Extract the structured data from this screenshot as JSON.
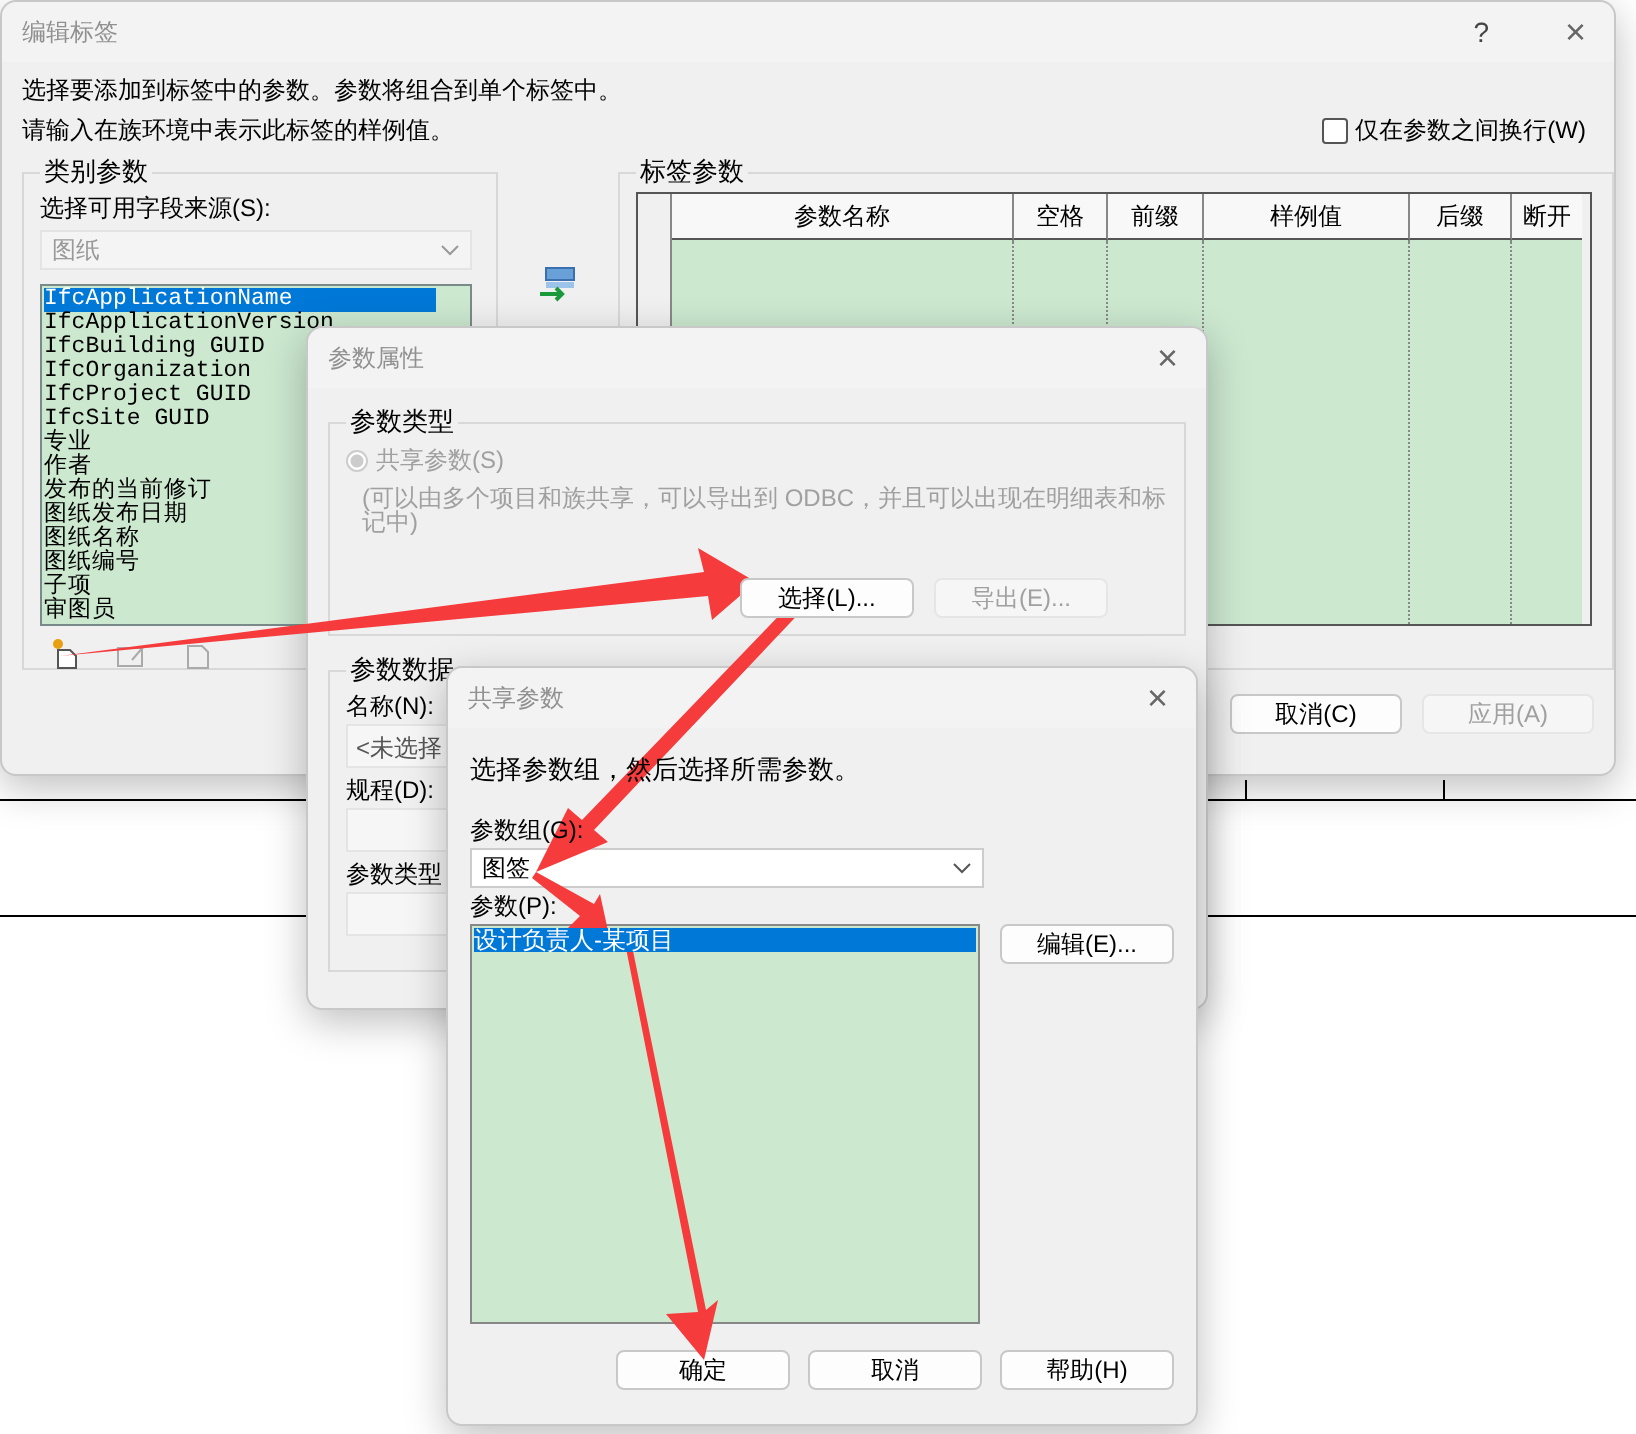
{
  "main_dialog": {
    "title": "编辑标签",
    "help": "?",
    "close": "×",
    "instructions": [
      "选择要添加到标签中的参数。参数将组合到单个标签中。",
      "请输入在族环境中表示此标签的样例值。"
    ],
    "wrap_option": {
      "label": "仅在参数之间换行(W)",
      "checked": false
    },
    "category_group": {
      "title": "类别参数",
      "source_label": "选择可用字段来源(S):",
      "source": {
        "value": "图纸",
        "disabled": true
      },
      "fields": [
        {
          "label": "IfcApplicationName",
          "selected": true
        },
        {
          "label": "IfcApplicationVersion",
          "selected": false
        },
        {
          "label": "IfcBuilding GUID",
          "selected": false
        },
        {
          "label": "IfcOrganization",
          "selected": false
        },
        {
          "label": "IfcProject GUID",
          "selected": false
        },
        {
          "label": "IfcSite GUID",
          "selected": false
        },
        {
          "label": "专业",
          "selected": false
        },
        {
          "label": "作者",
          "selected": false
        },
        {
          "label": "发布的当前修订",
          "selected": false
        },
        {
          "label": "图纸发布日期",
          "selected": false
        },
        {
          "label": "图纸名称",
          "selected": false
        },
        {
          "label": "图纸编号",
          "selected": false
        },
        {
          "label": "子项",
          "selected": false
        },
        {
          "label": "审图员",
          "selected": false
        }
      ]
    },
    "label_group": {
      "title": "标签参数",
      "columns": [
        "参数名称",
        "空格",
        "前缀",
        "样例值",
        "后缀",
        "断开"
      ]
    },
    "buttons": [
      {
        "label": "取消(C)",
        "disabled": false
      },
      {
        "label": "应用(A)",
        "disabled": true
      }
    ]
  },
  "properties_dialog": {
    "title": "参数属性",
    "close": "×",
    "type_group": {
      "title": "参数类型",
      "option": {
        "label": "共享参数(S)",
        "selected": true,
        "disabled": true
      },
      "note": "(可以由多个项目和族共享，可以导出到 ODBC，并且可以出现在明细表和标记中)",
      "buttons": [
        {
          "label": "选择(L)...",
          "disabled": false
        },
        {
          "label": "导出(E)...",
          "disabled": true
        }
      ]
    },
    "data_group": {
      "title": "参数数据",
      "fields": [
        {
          "label": "名称(N):",
          "value": "<未选择"
        },
        {
          "label": "规程(D):"
        },
        {
          "label": "参数类型"
        }
      ]
    }
  },
  "shared_dialog": {
    "title": "共享参数",
    "close": "×",
    "instruction": "选择参数组，然后选择所需参数。",
    "group_label": "参数组(G):",
    "group": {
      "value": "图签"
    },
    "params_label": "参数(P):",
    "params": [
      {
        "label": "设计负责人-某项目",
        "selected": true
      }
    ],
    "edit_button": "编辑(E)...",
    "buttons": [
      "确定",
      "取消",
      "帮助(H)"
    ]
  }
}
